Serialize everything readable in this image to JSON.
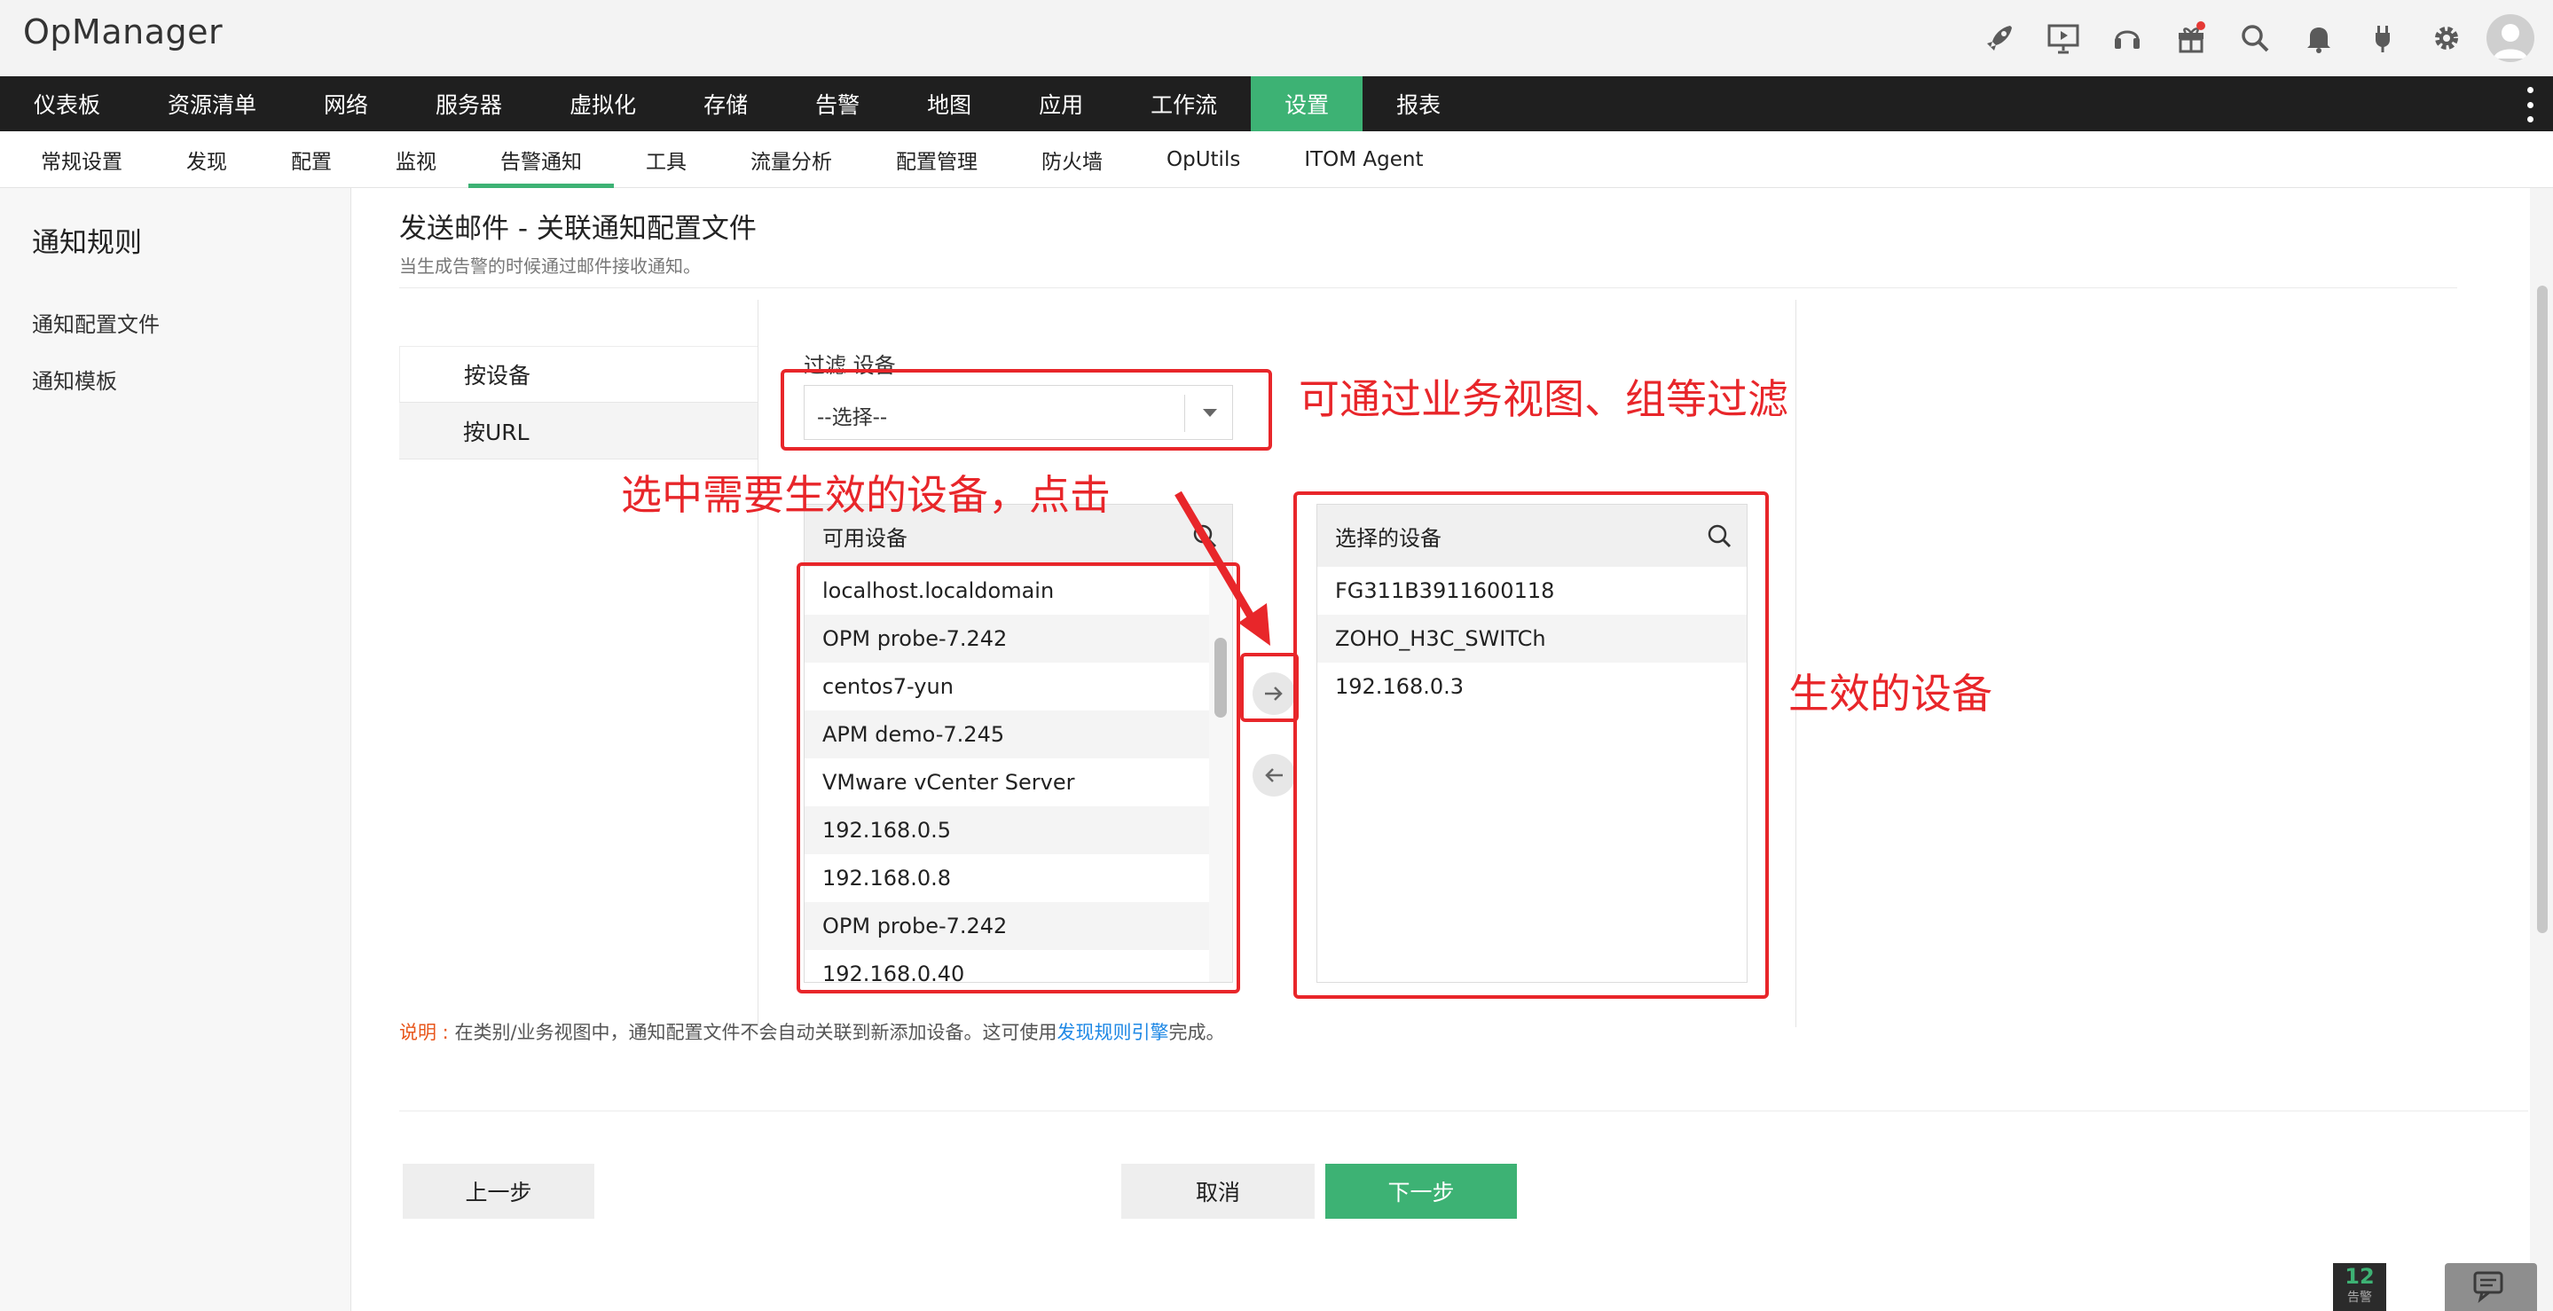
{
  "app": {
    "name": "OpManager"
  },
  "header_icons": [
    "rocket-icon",
    "presentation-icon",
    "headset-icon",
    "gift-icon",
    "search-icon",
    "bell-icon",
    "plug-icon",
    "gear-icon",
    "user-avatar-icon"
  ],
  "main_nav": [
    {
      "label": "仪表板"
    },
    {
      "label": "资源清单"
    },
    {
      "label": "网络"
    },
    {
      "label": "服务器"
    },
    {
      "label": "虚拟化"
    },
    {
      "label": "存储"
    },
    {
      "label": "告警"
    },
    {
      "label": "地图"
    },
    {
      "label": "应用"
    },
    {
      "label": "工作流"
    },
    {
      "label": "设置",
      "active": true
    },
    {
      "label": "报表"
    }
  ],
  "sub_nav": [
    {
      "label": "常规设置"
    },
    {
      "label": "发现"
    },
    {
      "label": "配置"
    },
    {
      "label": "监视"
    },
    {
      "label": "告警通知",
      "active": true
    },
    {
      "label": "工具"
    },
    {
      "label": "流量分析"
    },
    {
      "label": "配置管理"
    },
    {
      "label": "防火墙"
    },
    {
      "label": "OpUtils"
    },
    {
      "label": "ITOM Agent"
    }
  ],
  "sidebar": {
    "title": "通知规则",
    "items": [
      {
        "label": "通知配置文件"
      },
      {
        "label": "通知模板"
      }
    ]
  },
  "content": {
    "title": "发送邮件 - 关联通知配置文件",
    "subtitle": "当生成告警的时候通过邮件接收通知。",
    "tabs": [
      {
        "label": "按设备"
      },
      {
        "label": "按URL"
      }
    ],
    "filter": {
      "label": "过滤 设备",
      "value": "--选择--"
    },
    "available": {
      "header": "可用设备",
      "items": [
        "localhost.localdomain",
        "OPM probe-7.242",
        "centos7-yun",
        "APM demo-7.245",
        "VMware vCenter Server",
        "192.168.0.5",
        "192.168.0.8",
        "OPM probe-7.242",
        "192.168.0.40"
      ]
    },
    "selected": {
      "header": "选择的设备",
      "items": [
        "FG311B3911600118",
        "ZOHO_H3C_SWITCh",
        "192.168.0.3"
      ]
    },
    "note": {
      "label": "说明 :",
      "text": " 在类别/业务视图中，通知配置文件不会自动关联到新添加设备。这可使用",
      "link": "发现规则引擎",
      "tail": "完成。"
    },
    "buttons": {
      "prev": "上一步",
      "cancel": "取消",
      "next": "下一步"
    }
  },
  "alerts_badge": {
    "count": "12",
    "label": "告警"
  },
  "annotations": {
    "filter_note": "可通过业务视图、组等过滤",
    "select_note": "选中需要生效的设备，点击",
    "effective_note": "生效的设备",
    "color": "#e8262a"
  }
}
